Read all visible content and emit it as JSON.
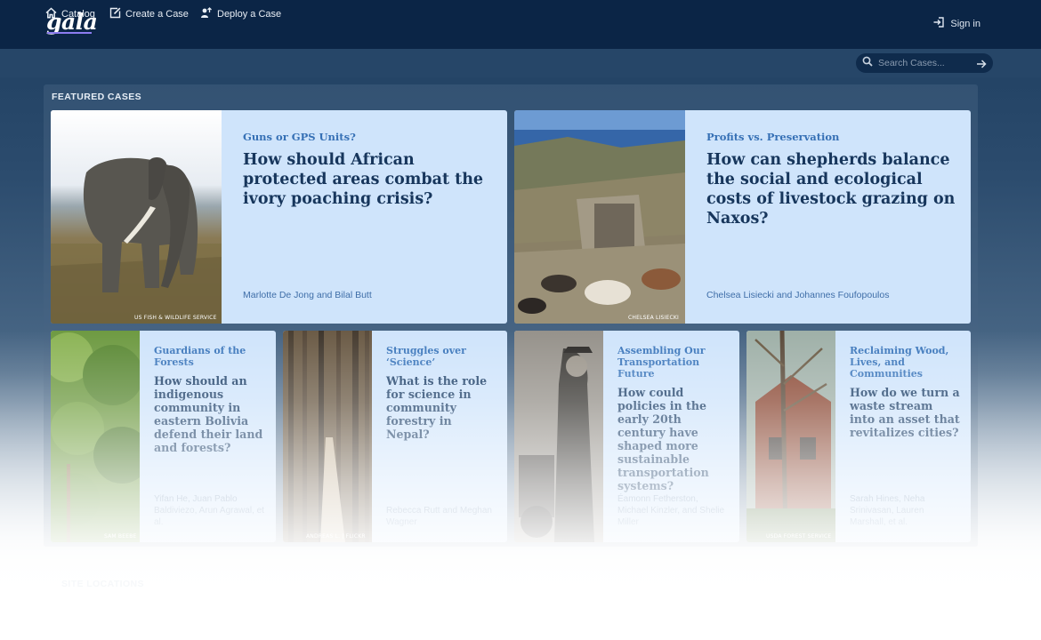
{
  "header": {
    "logo": "gala",
    "signin_label": "Sign in"
  },
  "nav": {
    "catalog": "Catalog",
    "create": "Create a Case",
    "deploy": "Deploy a Case",
    "search_placeholder": "Search Cases..."
  },
  "featured": {
    "title": "FEATURED CASES",
    "big_cards": [
      {
        "kicker": "Guns or GPS Units?",
        "question": "How should African protected areas combat the ivory poaching crisis?",
        "authors": "Marlotte De Jong and Bilal Butt",
        "credit": "US FISH & WILDLIFE SERVICE"
      },
      {
        "kicker": "Profits vs. Preservation",
        "question": "How can shepherds balance the social and ecological costs of livestock grazing on Naxos?",
        "authors": "Chelsea Lisiecki and Johannes Foufopoulos",
        "credit": "CHELSEA LISIECKI"
      }
    ],
    "small_cards": [
      {
        "kicker": "Guardians of the Forests",
        "question": "How should an indigenous community in eastern Bolivia defend their land and forests?",
        "authors": "Yifan He, Juan Pablo Baldiviezo, Arun Agrawal, et al.",
        "credit": "SAM BEEBE"
      },
      {
        "kicker": "Struggles over ‘Science’",
        "question": "What is the role for science in community forestry in Nepal?",
        "authors": "Rebecca Rutt and Meghan Wagner",
        "credit": "ANDREAS L. | FLICKR"
      },
      {
        "kicker": "Assembling Our Transportation Future",
        "question": "How could policies in the early 20th century have shaped more sustainable transportation systems?",
        "authors": "Éamonn Fetherston, Michael Kinzler, and Shelie Miller",
        "credit": ""
      },
      {
        "kicker": "Reclaiming Wood, Lives, and Communities",
        "question": "How do we turn a waste stream into an asset that revitalizes cities?",
        "authors": "Sarah Hines, Neha Srinivasan, Lauren Marshall, et al.",
        "credit": "USDA FOREST SERVICE"
      }
    ]
  },
  "site_locations": {
    "title": "SITE LOCATIONS"
  }
}
